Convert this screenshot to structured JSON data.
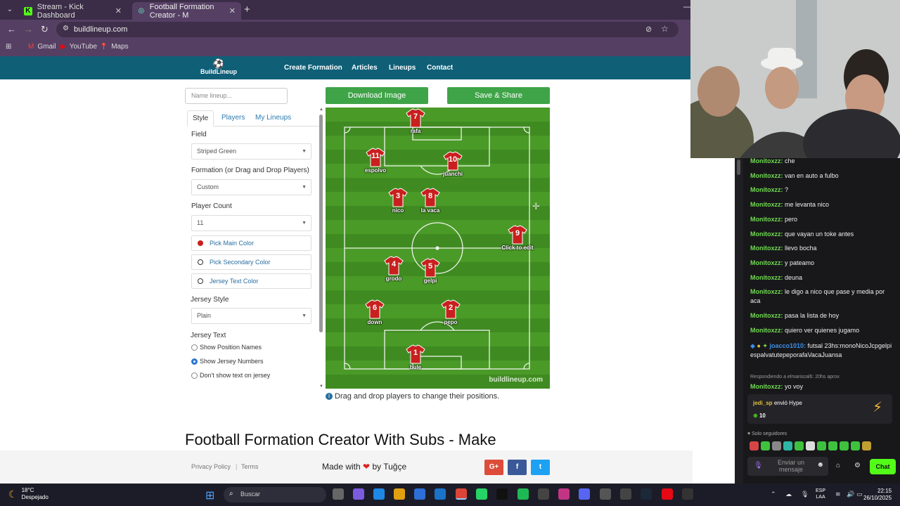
{
  "browser": {
    "tabs": [
      {
        "title": "Stream - Kick Dashboard",
        "favicon": "K"
      },
      {
        "title": "Football Formation Creator - M",
        "favicon": "◎"
      }
    ],
    "url": "buildlineup.com",
    "bookmarks": [
      {
        "label": "Gmail",
        "icon": "M"
      },
      {
        "label": "YouTube",
        "icon": "▶"
      },
      {
        "label": "Maps",
        "icon": "📍"
      }
    ]
  },
  "site": {
    "logo_text": "BuildLineup",
    "nav": [
      "Create Formation",
      "Articles",
      "Lineups",
      "Contact"
    ],
    "name_placeholder": "Name lineup...",
    "download_label": "Download Image",
    "save_label": "Save & Share",
    "panel_tabs": [
      "Style",
      "Players",
      "My Lineups"
    ],
    "field_label": "Field",
    "field_value": "Striped Green",
    "formation_label": "Formation (or Drag and Drop Players)",
    "formation_value": "Custom",
    "count_label": "Player Count",
    "count_value": "11",
    "main_color_label": "Pick Main Color",
    "main_color": "#c8201e",
    "secondary_color_label": "Pick Secondary Color",
    "jersey_text_color_label": "Jersey Text Color",
    "jersey_style_label": "Jersey Style",
    "jersey_style_value": "Plain",
    "jersey_text_label": "Jersey Text",
    "jersey_text_options": [
      "Show Position Names",
      "Show Jersey Numbers",
      "Don't show text on jersey"
    ],
    "jersey_text_selected": 1,
    "players": [
      {
        "num": "7",
        "name": "rafa"
      },
      {
        "num": "11",
        "name": "espolvo"
      },
      {
        "num": "10",
        "name": "juanchi"
      },
      {
        "num": "3",
        "name": "nico"
      },
      {
        "num": "8",
        "name": "la vaca"
      },
      {
        "num": "9",
        "name": "Click to edit"
      },
      {
        "num": "4",
        "name": "grodo"
      },
      {
        "num": "5",
        "name": "gelpi"
      },
      {
        "num": "6",
        "name": "down"
      },
      {
        "num": "2",
        "name": "pepo"
      },
      {
        "num": "1",
        "name": "bule"
      }
    ],
    "watermark": "buildlineup.com",
    "hint": "Drag and drop players to change their positions.",
    "headline": "Football Formation Creator With Subs - Make",
    "footer": {
      "privacy": "Privacy Policy",
      "sep": "|",
      "terms": "Terms",
      "made_with": "Made with",
      "by": "by Tuğçe",
      "social": [
        "G+",
        "f",
        "t"
      ]
    }
  },
  "chat": {
    "messages": [
      {
        "user": "Monitoxzz:",
        "text": "che"
      },
      {
        "user": "Monitoxzz:",
        "text": "van en auto a fulbo"
      },
      {
        "user": "Monitoxzz:",
        "text": "?"
      },
      {
        "user": "Monitoxzz:",
        "text": "me levanta nico"
      },
      {
        "user": "Monitoxzz:",
        "text": "pero"
      },
      {
        "user": "Monitoxzz:",
        "text": "que vayan un toke antes"
      },
      {
        "user": "Monitoxzz:",
        "text": "llevo bocha"
      },
      {
        "user": "Monitoxzz:",
        "text": "y pateamo"
      },
      {
        "user": "Monitoxzz:",
        "text": "deuna"
      },
      {
        "user": "Monitoxzz:",
        "text": "le digo a nico que pase y media por aca"
      },
      {
        "user": "Monitoxzz:",
        "text": "pasa la lista de hoy"
      },
      {
        "user": "Monitoxzz:",
        "text": "quiero ver quienes jugamo"
      }
    ],
    "special_message": {
      "user": "joacco1010:",
      "text": "futsal 23hs:monoNicoJcpgelpiespalvatutepeporafaVacaJuansa"
    },
    "reply_context": "Respondiendo a elmariscal6: 20hs aprox",
    "last_message": {
      "user": "Monitoxzz:",
      "text": "yo voy"
    },
    "hype_user": "jedi_sp",
    "hype_text": "envió Hype",
    "hype_amount": "10",
    "followers_only": "Solo seguidores",
    "input_placeholder": "Enviar un mensaje",
    "send_label": "Chat"
  },
  "taskbar": {
    "temp": "18°C",
    "weather": "Despejado",
    "search_placeholder": "Buscar",
    "lang_top": "ESP",
    "lang_bottom": "LAA",
    "time": "22:15",
    "date": "26/10/2025"
  }
}
